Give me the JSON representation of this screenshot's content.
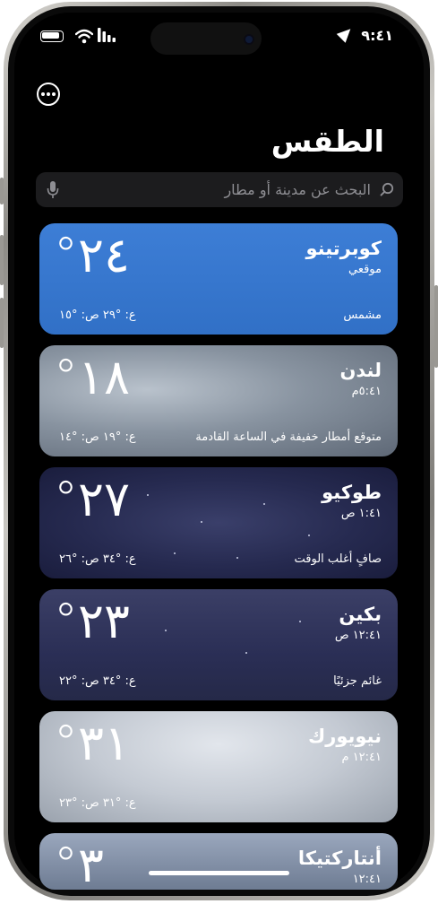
{
  "status_bar": {
    "time": "٩:٤١"
  },
  "header": {
    "title": "الطقس"
  },
  "search": {
    "placeholder": "البحث عن مدينة أو مطار"
  },
  "colors": {
    "accent": "#3478f6",
    "background": "#000000"
  },
  "cities": [
    {
      "name": "كوبرتينو",
      "subtitle": "موقعي",
      "temp": "°٢٤",
      "condition": "مشمس",
      "hilo": "ع: °٢٩ ص: °١٥"
    },
    {
      "name": "لندن",
      "subtitle": "٥:٤١م",
      "temp": "°١٨",
      "condition": "متوقع أمطار خفيفة في الساعة القادمة",
      "hilo": "ع: °١٩ ص: °١٤"
    },
    {
      "name": "طوكيو",
      "subtitle": "١:٤١ ص",
      "temp": "°٢٧",
      "condition": "صافٍ أغلب الوقت",
      "hilo": "ع: °٣٤ ص: °٢٦"
    },
    {
      "name": "بكين",
      "subtitle": "١٢:٤١ ص",
      "temp": "°٢٣",
      "condition": "غائم جزئيًا",
      "hilo": "ع: °٣٤ ص: °٢٢"
    },
    {
      "name": "نيويورك",
      "subtitle": "١٢:٤١ م",
      "temp": "°٣١",
      "condition": "",
      "hilo": "ع: °٣١ ص: °٢٣"
    },
    {
      "name": "أنتاركتيكا",
      "subtitle": "١٢:٤١",
      "temp": "°٣_",
      "condition": "",
      "hilo": ""
    }
  ]
}
